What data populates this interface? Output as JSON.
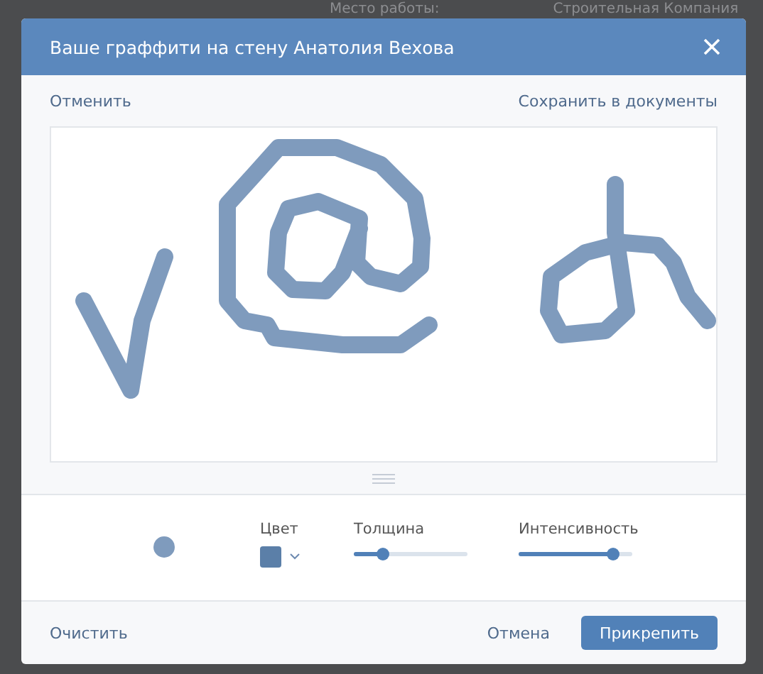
{
  "background": {
    "texts": [
      "Место работы:",
      "Строительная Компания"
    ]
  },
  "window": {
    "title": "Ваше граффити на стену Анатолия Вехова"
  },
  "top_actions": {
    "cancel": "Отменить",
    "save": "Сохранить в документы"
  },
  "tools": {
    "color": {
      "label": "Цвет",
      "color": "#5b7fa8"
    },
    "sliders": [
      {
        "label": "Толщина",
        "level": 0.25
      },
      {
        "label": "Интенсивность",
        "level": 0.82
      }
    ]
  },
  "footer": {
    "clear": "Очистить",
    "cancel": "Отмена",
    "attach": "Прикрепить"
  }
}
